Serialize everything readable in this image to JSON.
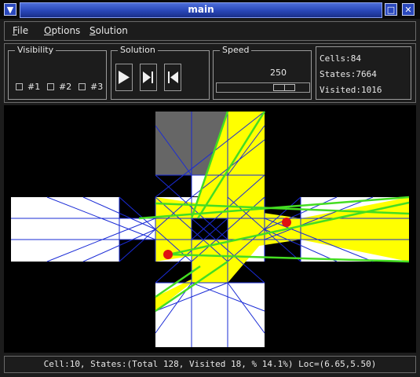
{
  "window": {
    "title": "main"
  },
  "menu": {
    "file_u": "F",
    "file_rest": "ile",
    "options_u": "O",
    "options_rest": "ptions",
    "solution_u": "S",
    "solution_rest": "olution"
  },
  "visibility": {
    "title": "Visibility",
    "options": [
      {
        "label": "#1",
        "checked": false
      },
      {
        "label": "#2",
        "checked": false
      },
      {
        "label": "#3",
        "checked": false
      }
    ]
  },
  "solution": {
    "title": "Solution",
    "buttons": [
      "play-icon",
      "step-forward-icon",
      "step-back-icon"
    ]
  },
  "speed": {
    "title": "Speed",
    "value": "250",
    "slider_fraction": 0.8
  },
  "stats": {
    "cells": "Cells:84",
    "states": "States:7664",
    "visited": "Visited:1016"
  },
  "status": {
    "text": "Cell:10, States:(Total 128, Visited 18, % 14.1%) Loc=(6.65,5.50)"
  },
  "colors": {
    "title_accent": "#2846b8",
    "lines": "#1a2bd6",
    "highlight": "#ffff00",
    "path": "#44dd22",
    "marker": "#e01010",
    "blocked": "#666666"
  }
}
